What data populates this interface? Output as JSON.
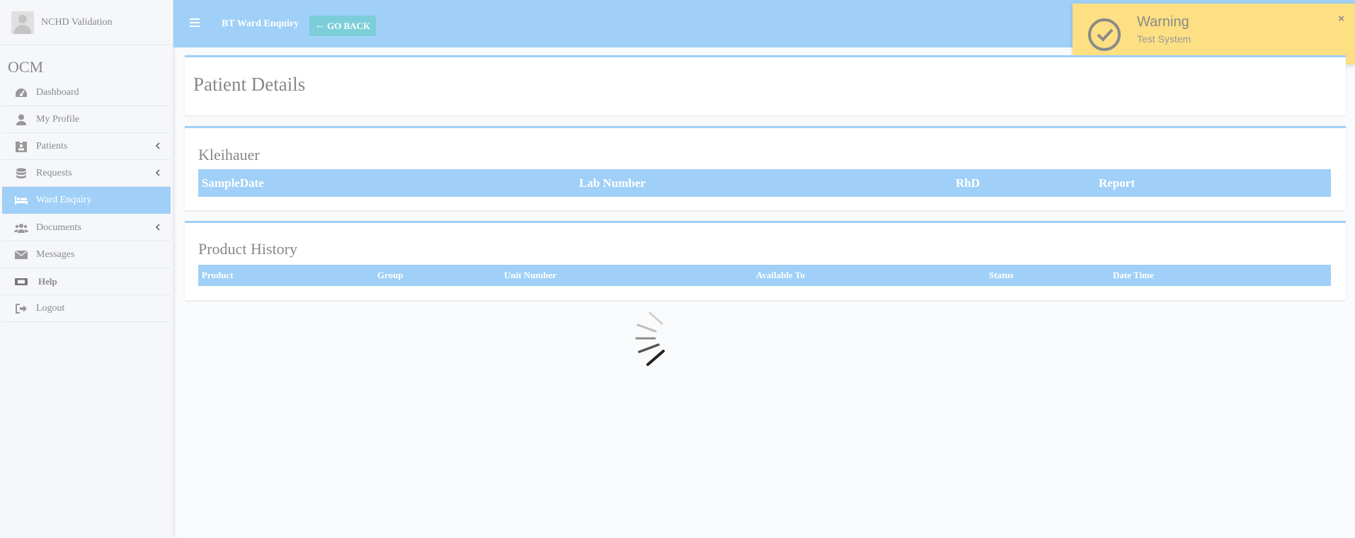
{
  "user": {
    "name": "NCHD Validation"
  },
  "brand": "OCM",
  "menu": [
    {
      "label": "Dashboard",
      "icon": "dashboard-icon"
    },
    {
      "label": "My Profile",
      "icon": "user-icon"
    },
    {
      "label": "Patients",
      "icon": "id-badge-icon",
      "submenu": true
    },
    {
      "label": "Requests",
      "icon": "database-icon",
      "submenu": true
    },
    {
      "label": "Ward Enquiry",
      "icon": "bed-icon",
      "active": true
    },
    {
      "label": "Documents",
      "icon": "users-icon",
      "submenu": true
    },
    {
      "label": "Messages",
      "icon": "envelope-icon"
    },
    {
      "label": "Help",
      "icon": "ticket-icon"
    },
    {
      "label": "Logout",
      "icon": "sign-out-icon"
    }
  ],
  "header": {
    "title": "BT Ward Enquiry",
    "back_label": "GO BACK"
  },
  "toast": {
    "title": "Warning",
    "message": "Test System",
    "close": "×"
  },
  "patient_details": {
    "title": "Patient Details"
  },
  "kleihauer": {
    "title": "Kleihauer",
    "columns": [
      "SampleDate",
      "Lab Number",
      "RhD",
      "Report"
    ]
  },
  "product_history": {
    "title": "Product History",
    "columns": [
      "Product",
      "Group",
      "Unit Number",
      "Available To",
      "Status",
      "Date Time"
    ]
  },
  "colors": {
    "accent": "#a0d0f7",
    "go_back": "#7ccfd8",
    "toast_bg": "#fde083"
  }
}
